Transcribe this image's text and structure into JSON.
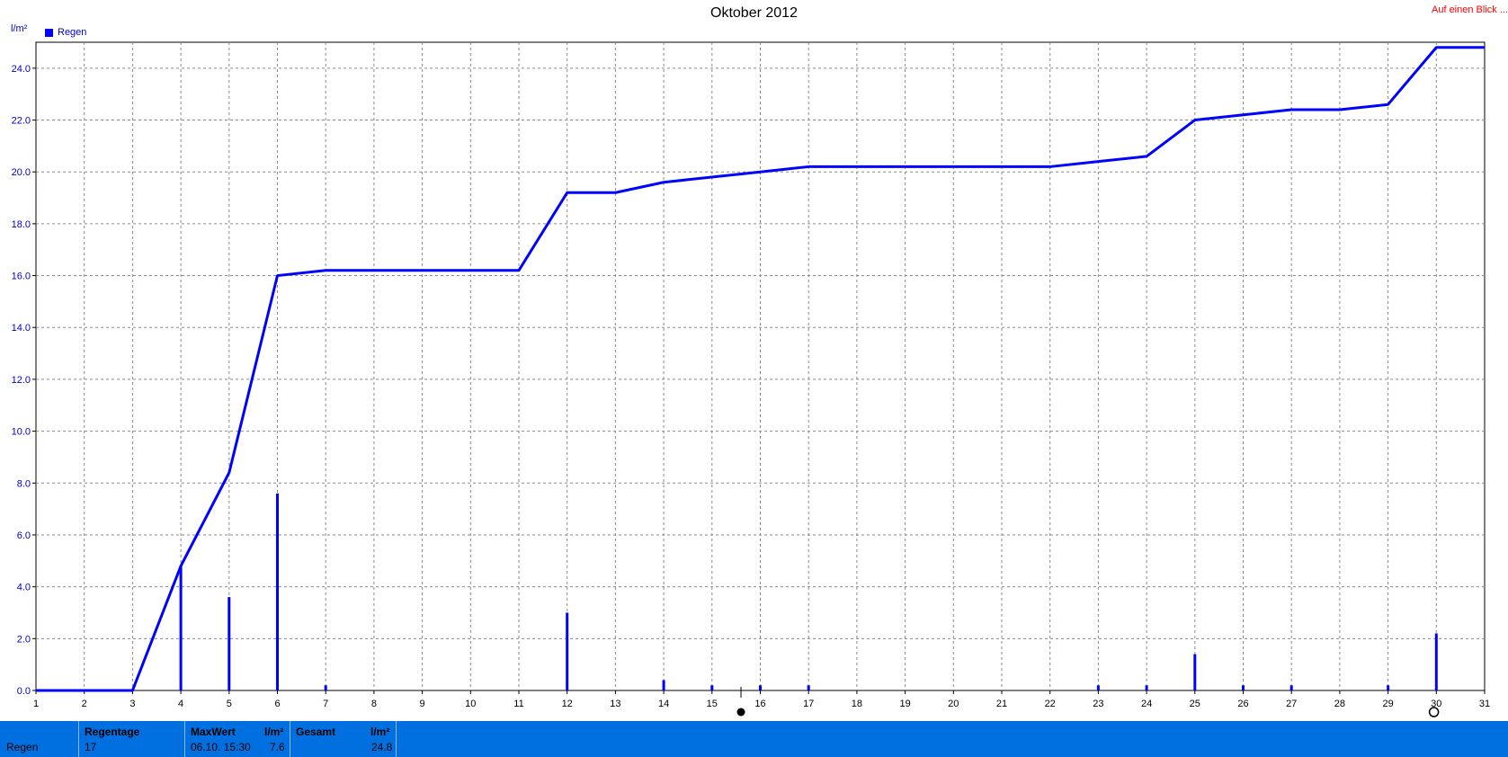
{
  "header": {
    "title": "Oktober 2012",
    "link_label": "Auf einen Blick ...",
    "unit_label": "l/m²",
    "legend_label": "Regen"
  },
  "colors": {
    "series": "#0000ff",
    "footer_bg": "#0070e0",
    "link": "#ff0000"
  },
  "chart_data": {
    "type": "line",
    "title": "Oktober 2012",
    "xlabel": "",
    "ylabel": "l/m²",
    "xlim": [
      1,
      31
    ],
    "ylim": [
      0,
      25
    ],
    "yticks": [
      "0.0",
      "2.0",
      "4.0",
      "6.0",
      "8.0",
      "10.0",
      "12.0",
      "14.0",
      "16.0",
      "18.0",
      "20.0",
      "22.0",
      "24.0"
    ],
    "xticks": [
      "1",
      "2",
      "3",
      "4",
      "5",
      "6",
      "7",
      "8",
      "9",
      "10",
      "11",
      "12",
      "13",
      "14",
      "15",
      "16",
      "17",
      "18",
      "19",
      "20",
      "21",
      "22",
      "23",
      "24",
      "25",
      "26",
      "27",
      "28",
      "29",
      "30",
      "31"
    ],
    "grid": true,
    "legend": "top-left",
    "series": [
      {
        "name": "Regen",
        "kind": "cumulative-line",
        "x": [
          1,
          3,
          4,
          5,
          6,
          7,
          11,
          12,
          13,
          14,
          16,
          17,
          22,
          23,
          24,
          25,
          26,
          27,
          28,
          29,
          30,
          31
        ],
        "y": [
          0,
          0,
          4.8,
          8.4,
          16.0,
          16.2,
          16.2,
          19.2,
          19.2,
          19.6,
          20.0,
          20.2,
          20.2,
          20.4,
          20.6,
          22.0,
          22.2,
          22.4,
          22.4,
          22.6,
          24.8,
          24.8
        ]
      },
      {
        "name": "Regen",
        "kind": "daily-bars",
        "x": [
          4,
          5,
          6,
          7,
          12,
          14,
          15,
          16,
          17,
          23,
          24,
          25,
          26,
          27,
          29,
          30
        ],
        "y": [
          4.8,
          3.6,
          7.6,
          0.2,
          3.0,
          0.4,
          0.2,
          0.2,
          0.2,
          0.2,
          0.2,
          1.4,
          0.2,
          0.2,
          0.2,
          2.2
        ]
      }
    ]
  },
  "footer": {
    "row_label": "Regen",
    "regentage_label": "Regentage",
    "regentage_value": "17",
    "maxwert_label": "MaxWert",
    "maxwert_unit": "l/m²",
    "maxwert_date": "06.10.  15:30",
    "maxwert_value": "7.6",
    "gesamt_label": "Gesamt",
    "gesamt_unit": "l/m²",
    "gesamt_value": "24.8"
  }
}
